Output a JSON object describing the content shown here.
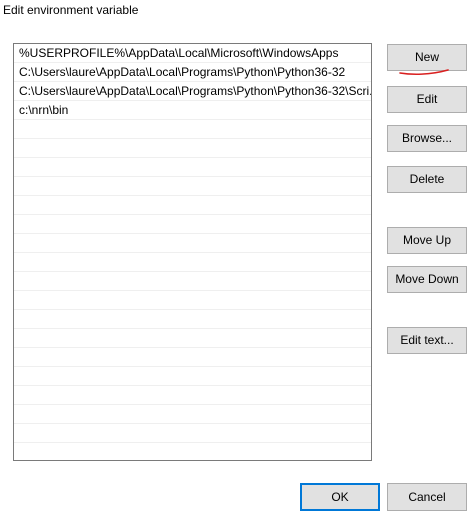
{
  "window": {
    "title": "Edit environment variable"
  },
  "list": {
    "items": [
      {
        "label": "%USERPROFILE%\\AppData\\Local\\Microsoft\\WindowsApps"
      },
      {
        "label": "C:\\Users\\laure\\AppData\\Local\\Programs\\Python\\Python36-32"
      },
      {
        "label": "C:\\Users\\laure\\AppData\\Local\\Programs\\Python\\Python36-32\\Scri..."
      },
      {
        "label": "c:\\nrn\\bin"
      }
    ]
  },
  "buttons": {
    "new": "New",
    "edit": "Edit",
    "browse": "Browse...",
    "delete": "Delete",
    "move_up": "Move Up",
    "move_down": "Move Down",
    "edit_text": "Edit text...",
    "ok": "OK",
    "cancel": "Cancel"
  },
  "colors": {
    "focus_border": "#0078d7",
    "annotation_stroke": "#d92020",
    "button_face": "#e1e1e1"
  }
}
